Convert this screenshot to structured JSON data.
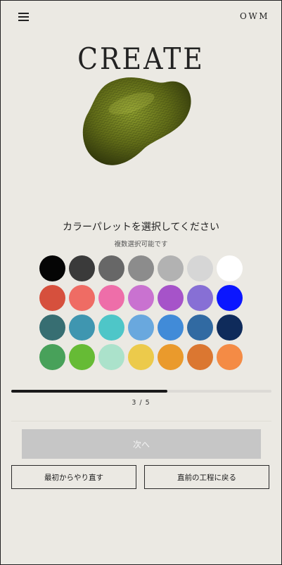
{
  "header": {
    "brand": "OWM",
    "menu_icon": "hamburger-menu-icon"
  },
  "title": "CREATE",
  "product_image": "olive-green-bean-shaped-object",
  "question": "カラーパレットを選択してください",
  "hint": "複数選択可能です",
  "palette": {
    "colors": [
      "#050505",
      "#3a3a3a",
      "#676767",
      "#8c8c8c",
      "#b2b2b2",
      "#d6d6d6",
      "#ffffff",
      "#d6503d",
      "#ef6c64",
      "#ee6ea9",
      "#c972d0",
      "#a653c9",
      "#876fd5",
      "#0b16ff",
      "#376e72",
      "#3f96b0",
      "#4ec6c8",
      "#69a8de",
      "#418bd8",
      "#316aa2",
      "#0f2b5b",
      "#48a15a",
      "#66bb35",
      "#abe2cb",
      "#ecca4b",
      "#ea9a2c",
      "#db7731",
      "#f48b45"
    ]
  },
  "progress": {
    "current": 3,
    "total": 5,
    "label": "3 / 5"
  },
  "buttons": {
    "next": "次へ",
    "restart": "最初からやり直す",
    "back": "直前の工程に戻る"
  }
}
